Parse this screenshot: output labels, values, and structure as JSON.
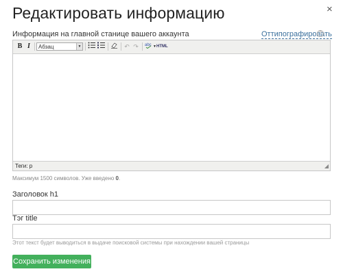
{
  "dialog": {
    "title": "Редактировать информацию",
    "close_glyph": "×"
  },
  "info": {
    "label": "Информация на главной станице вашего аккаунта",
    "typograph_link": "Оттипографировать",
    "help_glyph": "?"
  },
  "editor": {
    "toolbar": {
      "bold": "B",
      "italic": "I",
      "format_value": "Абзац",
      "html_label": "HTML"
    },
    "status_path": "Теги: p",
    "max_note_prefix": "Максимум 1500 символов. Уже введено ",
    "max_note_count": "0",
    "max_note_suffix": "."
  },
  "fields": {
    "h1_label": "Заголовок h1",
    "h1_value": "",
    "title_label": "Тэг title",
    "title_value": "",
    "hint": "Этот текст будет выводиться в выдаче поисковой системы при нахождении вашей страницы"
  },
  "save_label": "Сохранить изменения",
  "colors": {
    "save_bg": "#43b05c",
    "link": "#3a6f9c"
  }
}
